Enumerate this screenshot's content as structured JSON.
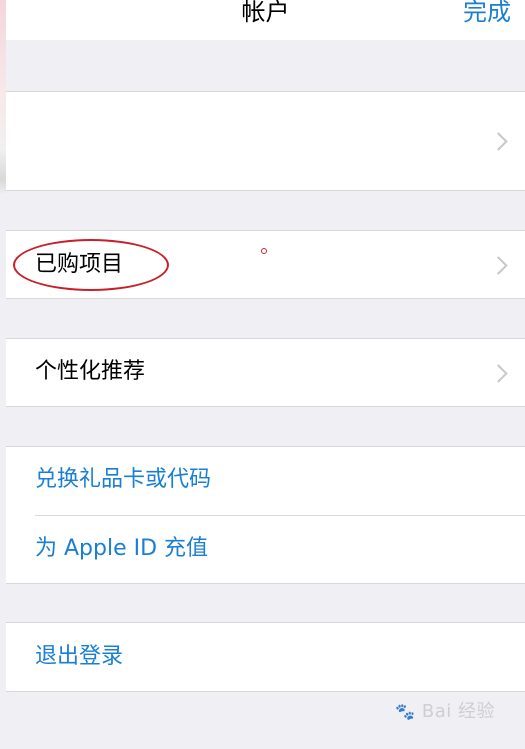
{
  "nav": {
    "title": "帐户",
    "done_label": "完成"
  },
  "cells": {
    "purchased": "已购项目",
    "personalized": "个性化推荐",
    "redeem": "兑换礼品卡或代码",
    "add_funds": "为 Apple ID 充值",
    "sign_out": "退出登录"
  },
  "watermark": {
    "text": "Bai 经验"
  },
  "colors": {
    "accent": "#1a7fd4",
    "background": "#efeff4",
    "annotation": "#c8202a"
  }
}
